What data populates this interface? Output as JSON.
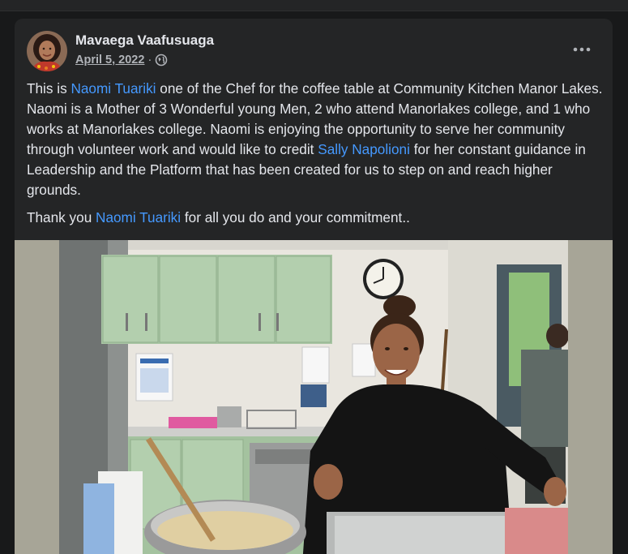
{
  "post": {
    "author": "Mavaega Vaafusuaga",
    "date": "April 5, 2022",
    "separator": "·",
    "privacy_icon": "globe-icon",
    "more_icon": "more-options-icon",
    "paragraph1": {
      "t1": "This is ",
      "mention1": "Naomi Tuariki",
      "t2": " one of the Chef for the coffee table at Community Kitchen Manor Lakes.  Naomi is a Mother of 3 Wonderful young Men, 2 who attend Manorlakes college, and 1 who works at Manorlakes college.  Naomi is enjoying the opportunity to serve her community through volunteer work and would like to credit ",
      "mention2": "Sally Napolioni",
      "t3": " for her constant guidance in Leadership and the Platform that has been created for us to step on and reach higher grounds."
    },
    "paragraph2": {
      "t1": "Thank you ",
      "mention1": "Naomi Tuariki",
      "t2": " for all you do and your commitment.."
    }
  },
  "colors": {
    "page_bg": "#18191a",
    "card_bg": "#242526",
    "primary_text": "#e4e6eb",
    "secondary_text": "#b0b3b8",
    "link": "#4599ff"
  }
}
